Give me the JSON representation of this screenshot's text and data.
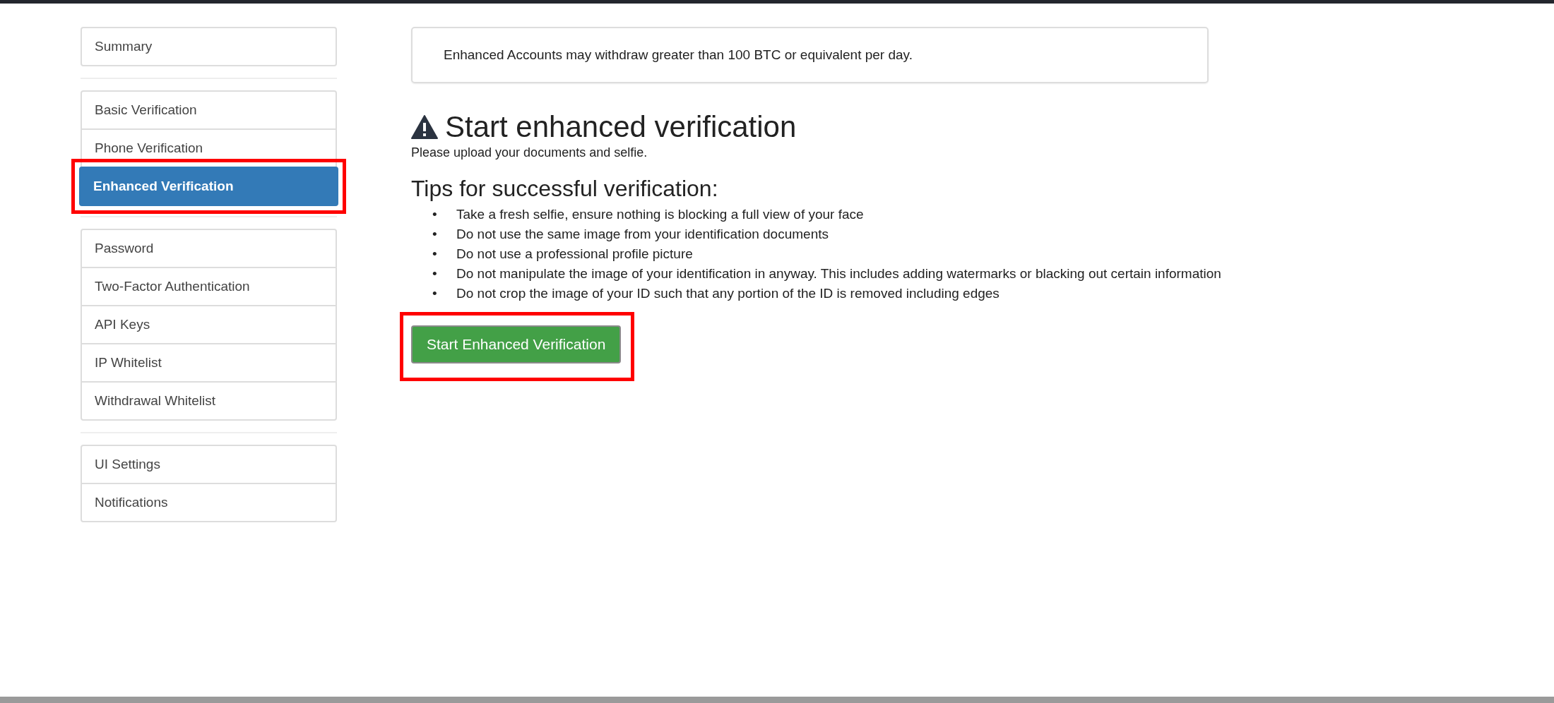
{
  "sidebar": {
    "groups": [
      {
        "items": [
          {
            "label": "Summary",
            "selected": false,
            "highlighted": false
          }
        ]
      },
      {
        "items": [
          {
            "label": "Basic Verification",
            "selected": false,
            "highlighted": false
          },
          {
            "label": "Phone Verification",
            "selected": false,
            "highlighted": false
          },
          {
            "label": "Enhanced Verification",
            "selected": true,
            "highlighted": true
          }
        ]
      },
      {
        "items": [
          {
            "label": "Password",
            "selected": false,
            "highlighted": false
          },
          {
            "label": "Two-Factor Authentication",
            "selected": false,
            "highlighted": false
          },
          {
            "label": "API Keys",
            "selected": false,
            "highlighted": false
          },
          {
            "label": "IP Whitelist",
            "selected": false,
            "highlighted": false
          },
          {
            "label": "Withdrawal Whitelist",
            "selected": false,
            "highlighted": false
          }
        ]
      },
      {
        "items": [
          {
            "label": "UI Settings",
            "selected": false,
            "highlighted": false
          },
          {
            "label": "Notifications",
            "selected": false,
            "highlighted": false
          }
        ]
      }
    ]
  },
  "notice": "Enhanced Accounts may withdraw greater than 100 BTC or equivalent per day.",
  "heading": "Start enhanced verification",
  "subtitle": "Please upload your documents and selfie.",
  "tips": {
    "title": "Tips for successful verification:",
    "items": [
      {
        "bullet": "•",
        "text": "Take a fresh selfie, ensure nothing is blocking a full view of your face"
      },
      {
        "bullet": "•",
        "text": "Do not use the same image from your identification documents"
      },
      {
        "bullet": "•",
        "text": "Do not use a professional profile picture"
      },
      {
        "bullet": "•",
        "text": "Do not manipulate the image of your identification in anyway. This includes adding watermarks or blacking out certain information"
      },
      {
        "bullet": "•",
        "text": "Do not crop the image of your ID such that any portion of the ID is removed including edges"
      }
    ]
  },
  "button": {
    "label": "Start Enhanced Verification",
    "highlighted": true
  }
}
